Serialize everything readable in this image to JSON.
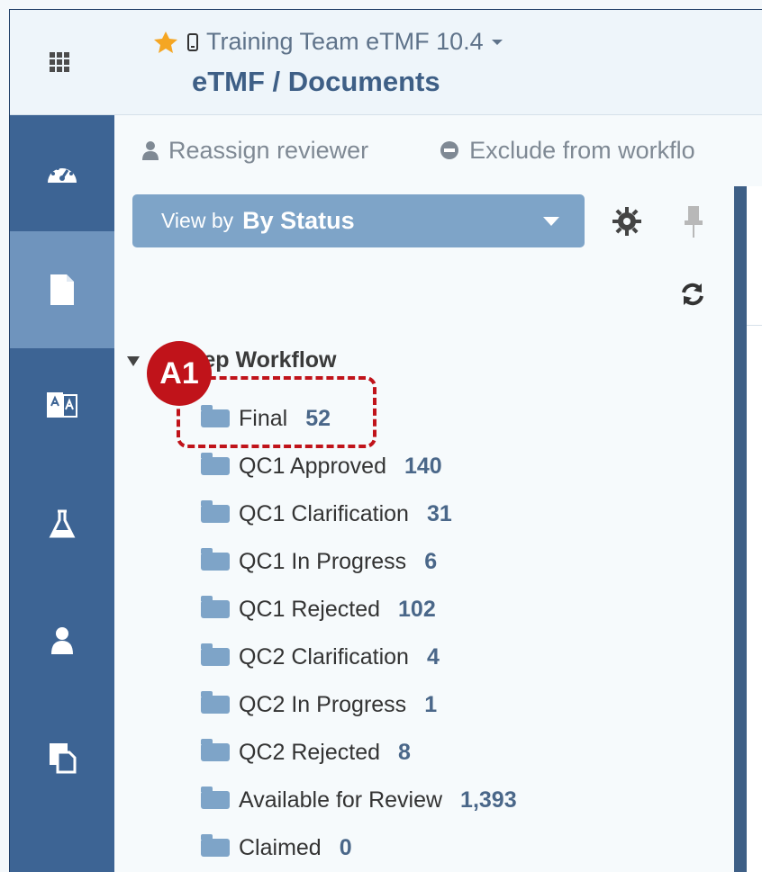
{
  "header": {
    "app_name": "Training Team eTMF 10.4",
    "page_title": "eTMF / Documents"
  },
  "toolbar": {
    "reassign_label": "Reassign reviewer",
    "exclude_label": "Exclude from workflo"
  },
  "view_by": {
    "label": "View by",
    "value": "By Status"
  },
  "tree": {
    "group_label": "tep Workflow",
    "badge_label": "A1"
  },
  "tree_items": [
    {
      "label": "Final",
      "count": "52"
    },
    {
      "label": "QC1 Approved",
      "count": "140"
    },
    {
      "label": "QC1 Clarification",
      "count": "31"
    },
    {
      "label": "QC1 In Progress",
      "count": "6"
    },
    {
      "label": "QC1 Rejected",
      "count": "102"
    },
    {
      "label": "QC2 Clarification",
      "count": "4"
    },
    {
      "label": "QC2 In Progress",
      "count": "1"
    },
    {
      "label": "QC2 Rejected",
      "count": "8"
    },
    {
      "label": "Available for Review",
      "count": "1,393"
    },
    {
      "label": "Claimed",
      "count": "0"
    }
  ],
  "icons": {
    "apps": "apps-grid-icon",
    "favorite": "star-icon",
    "mobile": "mobile-icon",
    "dashboard": "dashboard-icon",
    "documents": "document-icon",
    "translate": "translate-icon",
    "lab": "flask-icon",
    "user": "user-icon",
    "copy": "copy-icon",
    "settings": "gear-icon",
    "pin": "pin-icon",
    "refresh": "refresh-icon"
  },
  "colors": {
    "accent": "#3d6494",
    "highlight": "#c0131a",
    "view_by_bg": "#7ea4c8"
  }
}
